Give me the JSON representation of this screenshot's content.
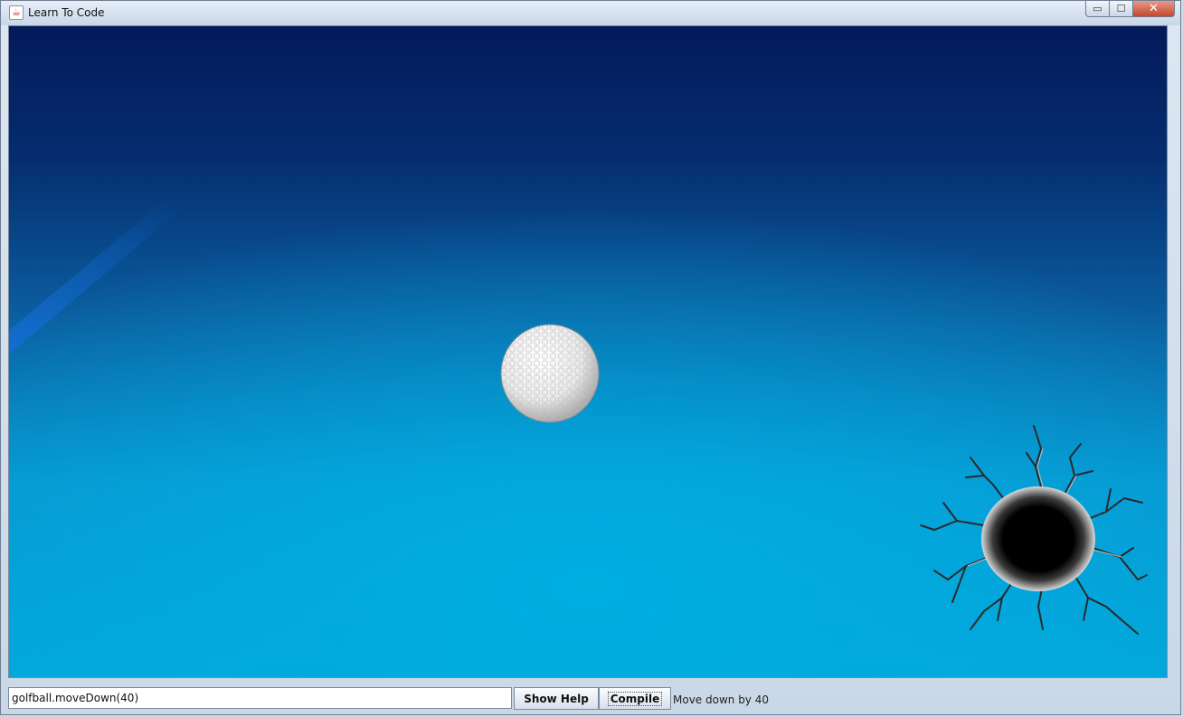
{
  "window": {
    "title": "Learn To Code",
    "app_icon": "java-icon",
    "controls": {
      "minimize_icon": "minimize-icon",
      "maximize_icon": "maximize-icon",
      "close_icon": "close-icon",
      "minimize_glyph": "▭",
      "maximize_glyph": "☐",
      "close_glyph": "✕"
    }
  },
  "scene": {
    "background_top_color": "#031a5a",
    "background_bottom_color": "#03a6da",
    "ball_icon": "golf-ball-icon",
    "hole_icon": "cracked-hole-icon"
  },
  "controls": {
    "command_input": {
      "value": "golfball.moveDown(40)",
      "placeholder": ""
    },
    "show_help_label": "Show Help",
    "compile_label": "Compile",
    "status_text": "Move down by 40"
  }
}
